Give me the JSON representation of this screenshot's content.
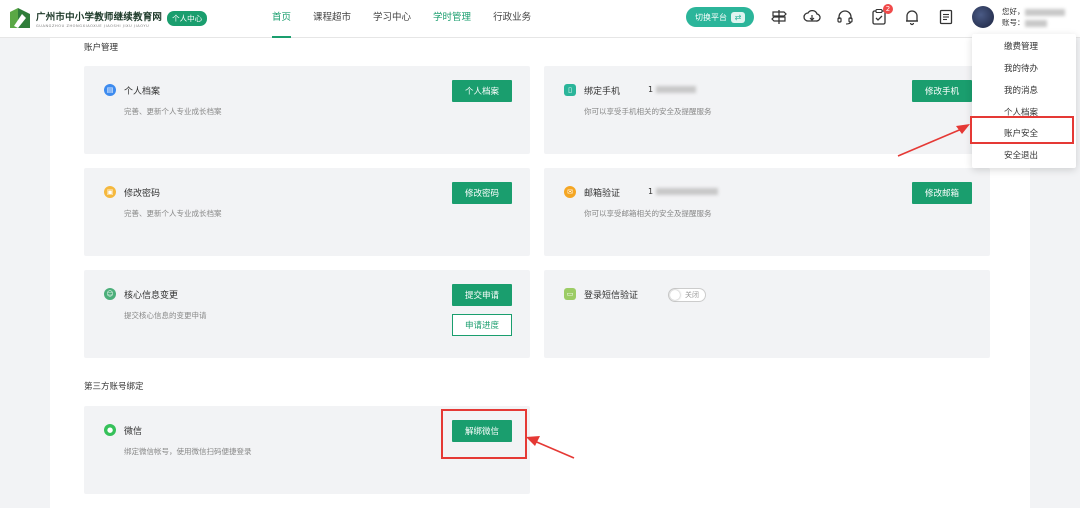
{
  "header": {
    "logo_text": "广州市中小学教师继续教育网",
    "logo_sub": "GUANGZHOU ZHONGXIAOXUE JIAOSHI JIXU JIAOYU",
    "center_badge": "个人中心",
    "nav": [
      "首页",
      "课程超市",
      "学习中心",
      "学时管理",
      "行政业务"
    ],
    "switch_platform": "切换平台",
    "notification_count": "2",
    "greeting_line1": "您好，",
    "greeting_line2": "账号：",
    "colors": {
      "primary": "#1a9e6e",
      "highlight": "#e53935"
    }
  },
  "dropdown": {
    "items": [
      "缴费管理",
      "我的待办",
      "我的消息",
      "个人档案",
      "账户安全",
      "安全退出"
    ],
    "highlighted": "账户安全"
  },
  "account": {
    "section_title": "账户管理",
    "profile": {
      "title": "个人档案",
      "desc": "完善、更新个人专业成长档案",
      "button": "个人档案",
      "icon": "file-icon"
    },
    "phone": {
      "title": "绑定手机",
      "value": "1",
      "desc": "你可以享受手机相关的安全及提醒服务",
      "button": "修改手机",
      "icon": "phone-icon"
    },
    "password": {
      "title": "修改密码",
      "desc": "完善、更新个人专业成长档案",
      "button": "修改密码",
      "icon": "lock-icon"
    },
    "email": {
      "title": "邮箱验证",
      "value": "1",
      "desc": "你可以享受邮箱相关的安全及提醒服务",
      "button": "修改邮箱",
      "icon": "mail-icon"
    },
    "core_info": {
      "title": "核心信息变更",
      "desc": "提交核心信息的变更申请",
      "button_submit": "提交申请",
      "button_progress": "申请进度",
      "icon": "user-icon"
    },
    "sms": {
      "title": "登录短信验证",
      "toggle_label": "关闭",
      "toggle_on": false,
      "icon": "message-icon"
    }
  },
  "third_party": {
    "section_title": "第三方账号绑定",
    "wechat": {
      "title": "微信",
      "desc": "绑定微信帐号，使用微信扫码便捷登录",
      "button": "解绑微信",
      "icon": "wechat-icon"
    }
  }
}
